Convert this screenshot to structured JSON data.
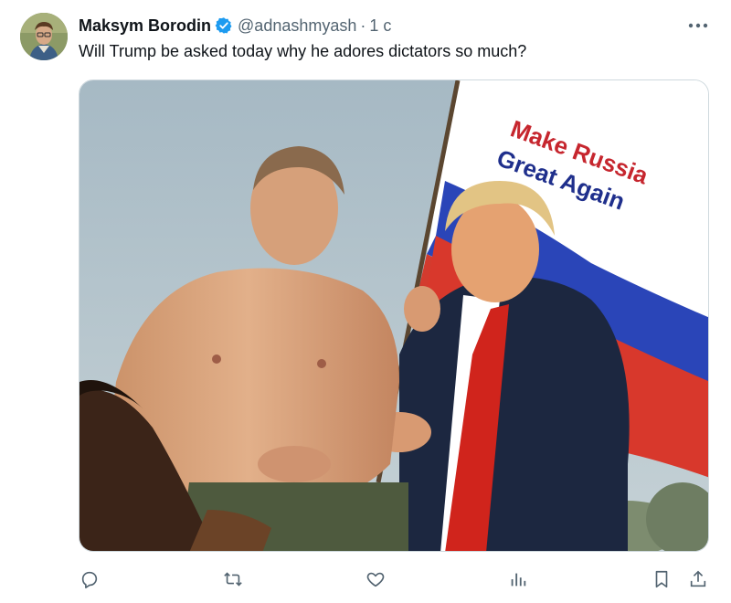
{
  "tweet": {
    "author_name": "Maksym Borodin",
    "handle": "@adnashmyash",
    "separator": "·",
    "time": "1 с",
    "text": "Will Trump be asked today why he adores dictators so much?",
    "verified_color": "#1d9bf0",
    "icons": {
      "more": "more-dots-icon",
      "reply": "reply-icon",
      "retweet": "retweet-icon",
      "like": "like-icon",
      "views": "views-icon",
      "bookmark": "bookmark-icon",
      "share": "share-icon"
    }
  },
  "media": {
    "flag_text_line1": "Make Russia",
    "flag_text_line2": "Great Again"
  }
}
